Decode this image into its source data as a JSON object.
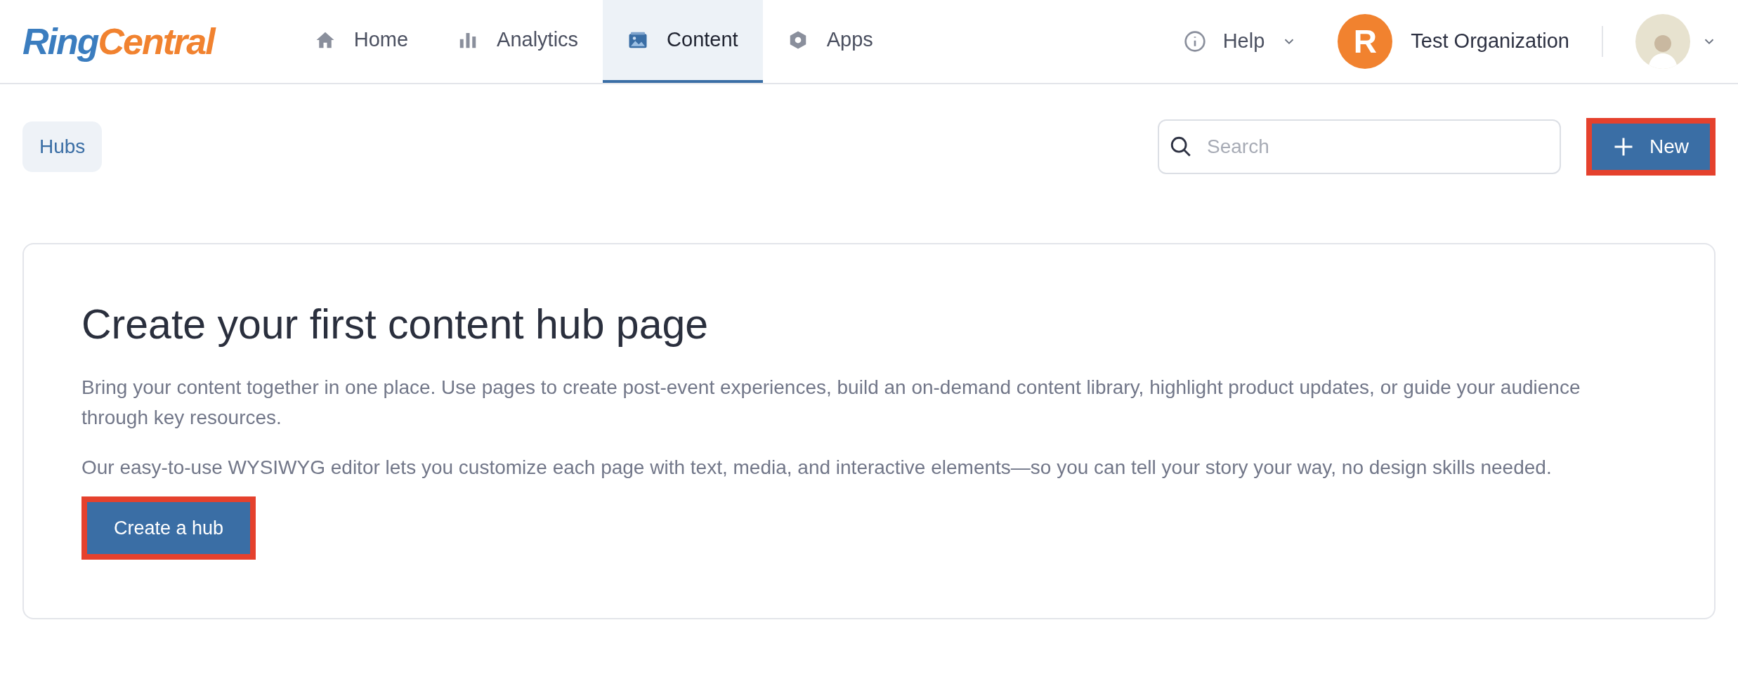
{
  "logo": {
    "first": "Ring",
    "second": "Central"
  },
  "nav": [
    {
      "label": "Home",
      "kind": "home",
      "selected": false
    },
    {
      "label": "Analytics",
      "kind": "analytics",
      "selected": false
    },
    {
      "label": "Content",
      "kind": "content",
      "selected": true
    },
    {
      "label": "Apps",
      "kind": "apps",
      "selected": false
    }
  ],
  "help": {
    "label": "Help"
  },
  "organization": {
    "initial": "R",
    "name": "Test Organization"
  },
  "toolbar": {
    "breadcrumb": "Hubs",
    "search": {
      "placeholder": "Search"
    },
    "new_button": {
      "label": "New",
      "highlighted": true
    }
  },
  "empty_state": {
    "title": "Create your first content hub page",
    "paragraphs": [
      "Bring your content together in one place. Use pages to create post-event experiences, build an on-demand content library, highlight product updates, or guide your audience through key resources.",
      "Our easy-to-use WYSIWYG editor lets you customize each page with text, media, and interactive elements—so you can tell your story your way, no design skills needed."
    ],
    "button": {
      "label": "Create a hub",
      "highlighted": true
    }
  }
}
